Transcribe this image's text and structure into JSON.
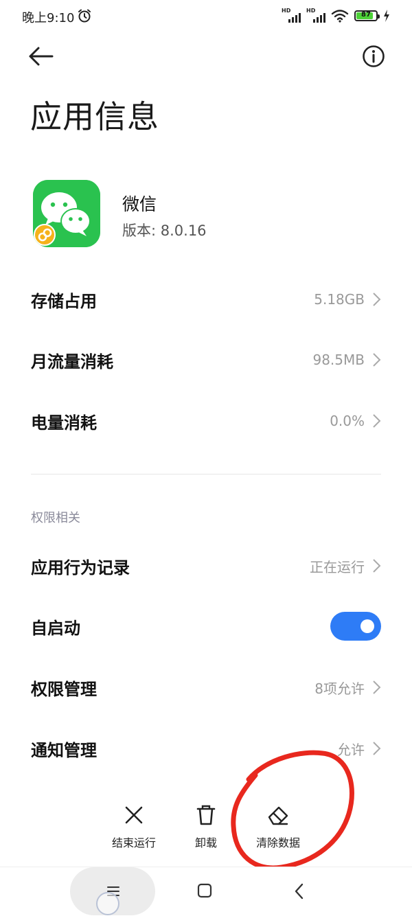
{
  "status_bar": {
    "time": "晚上9:10",
    "signal1_label": "HD",
    "signal2_label": "HD",
    "battery_level": "87",
    "battery_fraction": 0.87
  },
  "header": {
    "title": "应用信息"
  },
  "app": {
    "name": "微信",
    "version": "版本: 8.0.16"
  },
  "usage": [
    {
      "label": "存储占用",
      "value": "5.18GB"
    },
    {
      "label": "月流量消耗",
      "value": "98.5MB"
    },
    {
      "label": "电量消耗",
      "value": "0.0%"
    }
  ],
  "permissions": {
    "section_title": "权限相关",
    "app_behavior": {
      "label": "应用行为记录",
      "value": "正在运行"
    },
    "autostart": {
      "label": "自启动",
      "enabled": true
    },
    "permission_manage": {
      "label": "权限管理",
      "value": "8项允许"
    },
    "notification_manage": {
      "label": "通知管理",
      "value": "允许"
    }
  },
  "actions": {
    "force_stop": "结束运行",
    "uninstall": "卸载",
    "clear_data": "清除数据"
  },
  "colors": {
    "accent": "#2e7cf6",
    "wechat_green": "#2ac24f",
    "annotation": "#e8281e"
  },
  "icons": {
    "back": "arrow-left-icon",
    "info": "info-circle-icon",
    "chevron": "chevron-right-icon",
    "force_stop": "close-x-icon",
    "uninstall": "trash-icon",
    "clear_data": "eraser-icon",
    "nav_menu": "menu-lines-icon",
    "nav_home": "square-home-icon",
    "nav_back": "chevron-left-icon"
  }
}
